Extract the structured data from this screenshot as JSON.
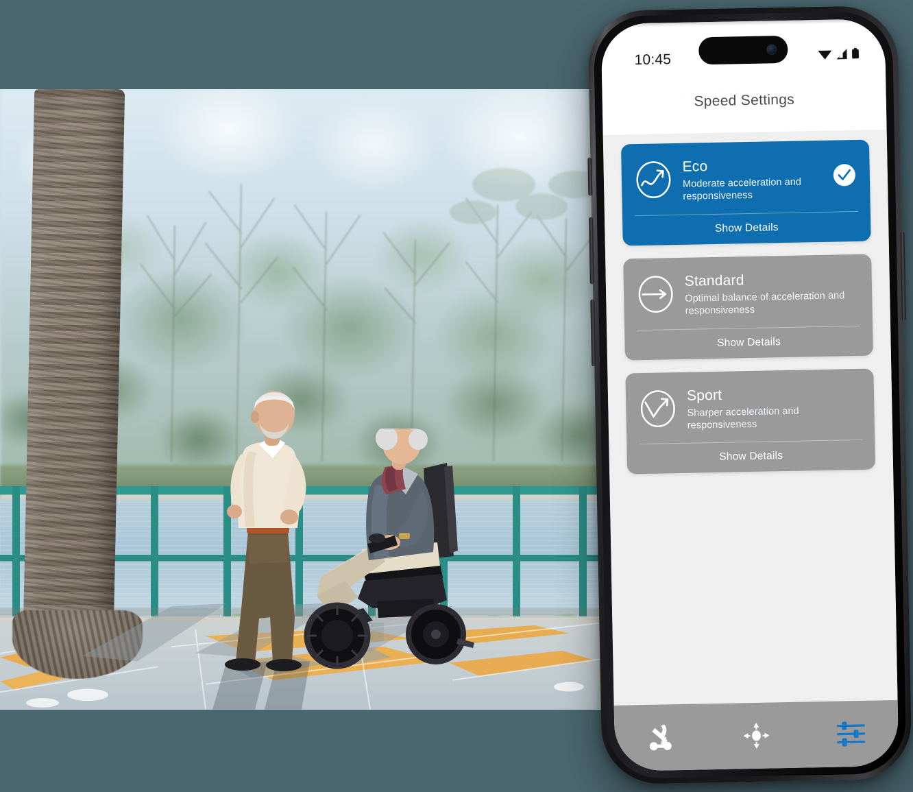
{
  "background_color": "#4A6770",
  "photo": {
    "alt_description": "Elderly man walking beside elderly woman riding a modern power wheelchair along a waterfront promenade with teal railing, palm tree and wet pavement",
    "scene_elements": [
      "palm-tree",
      "blurred-treeline",
      "lake-water",
      "teal-railing",
      "sidewalk",
      "wet-pavement-reflection",
      "orange-tactile-paving"
    ]
  },
  "phone": {
    "status_bar": {
      "time": "10:45",
      "icons": [
        "wifi-icon",
        "cellular-signal-icon",
        "battery-icon"
      ]
    },
    "nav": {
      "title": "Speed Settings"
    },
    "screen_bg": "#EFEFEF",
    "accent_color": "#0F6EAF",
    "inactive_color": "#9A9A9A",
    "cards": [
      {
        "id": "eco",
        "title": "Eco",
        "description": "Moderate acceleration and responsiveness",
        "footer_label": "Show Details",
        "selected": true,
        "icon": "wave-arrow-icon"
      },
      {
        "id": "standard",
        "title": "Standard",
        "description": "Optimal balance of acceleration and responsiveness",
        "footer_label": "Show Details",
        "selected": false,
        "icon": "straight-arrow-icon"
      },
      {
        "id": "sport",
        "title": "Sport",
        "description": "Sharper acceleration and responsiveness",
        "footer_label": "Show Details",
        "selected": false,
        "icon": "zigzag-arrow-icon"
      }
    ],
    "tab_bar": {
      "background": "#9A9A9A",
      "tabs": [
        {
          "id": "chair",
          "icon": "wheelchair-icon",
          "active": false,
          "color": "#FFFFFF"
        },
        {
          "id": "drive",
          "icon": "joystick-icon",
          "active": false,
          "color": "#FFFFFF"
        },
        {
          "id": "settings",
          "icon": "sliders-icon",
          "active": true,
          "color": "#1878C8"
        }
      ]
    }
  }
}
